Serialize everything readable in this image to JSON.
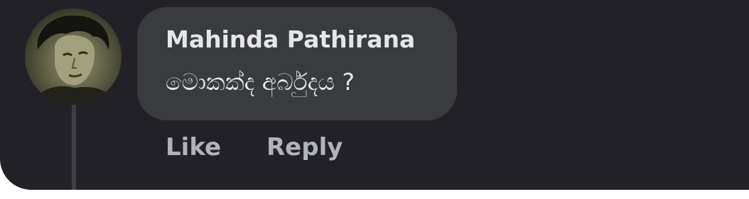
{
  "comment": {
    "author": "Mahinda Pathirana",
    "text": "මොකක්ද අර්බුදය ?",
    "avatar_icon": "profile-photo"
  },
  "actions": {
    "like_label": "Like",
    "reply_label": "Reply"
  },
  "colors": {
    "panel_background": "#212127",
    "bubble_background": "#3a3b3f",
    "primary_text": "#e4e6eb",
    "secondary_text": "#b0b3b8",
    "thread_line": "#3d3f45"
  }
}
